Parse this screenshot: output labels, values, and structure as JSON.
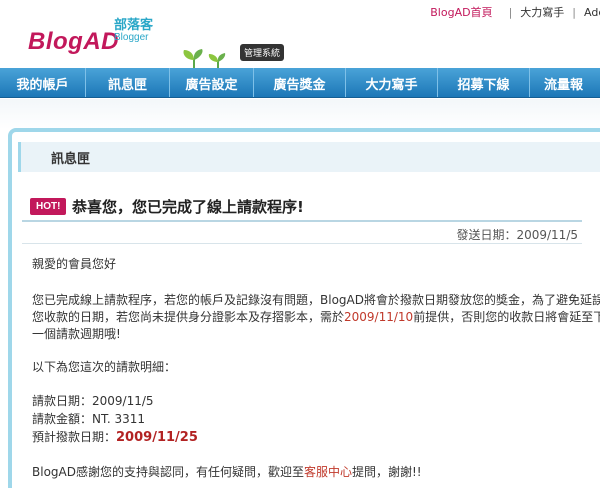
{
  "header": {
    "logo": "BlogAD",
    "logo_sub_zh": "部落客",
    "logo_sub_en": "Blogger",
    "mgmt_badge": "管理系統",
    "toplinks": {
      "home": "BlogAD首頁",
      "writer": "大力寫手",
      "clipped": "Adc"
    }
  },
  "nav": {
    "items": [
      {
        "label": "我的帳戶"
      },
      {
        "label": "訊息匣"
      },
      {
        "label": "廣告設定"
      },
      {
        "label": "廣告獎金"
      },
      {
        "label": "大力寫手"
      },
      {
        "label": "招募下線"
      },
      {
        "label": "流量報"
      }
    ]
  },
  "section": {
    "title": "訊息匣"
  },
  "message": {
    "hot_badge": "HOT!",
    "title": "恭喜您，您已完成了線上請款程序!",
    "sent_date": "發送日期：2009/11/5",
    "greeting": "親愛的會員您好",
    "para1_line1": "您已完成線上請款程序，若您的帳戶及記錄沒有問題，BlogAD將會於撥款日期發放您的獎金，為了避免延誤",
    "para1_line2_a": "您收款的日期，若您尚未提供身分證影本及存摺影本，需於",
    "para1_line2_date": "2009/11/10",
    "para1_line2_b": "前提供，否則您的收款日將會延至下",
    "para1_line3": "一個請款週期哦!",
    "details_intro": "以下為您這次的請款明細：",
    "request_date": "請款日期：2009/11/5",
    "request_amount": "請款金額：NT. 3311",
    "payout_label": "預計撥款日期：",
    "payout_date": "2009/11/25",
    "thanks_a": "BlogAD感謝您的支持與認同，有任何疑問，歡迎至",
    "thanks_link": "客服中心",
    "thanks_b": "提問，謝謝!!"
  },
  "colors": {
    "brand": "#c2185b",
    "nav_blue": "#1c77b7",
    "accent_cyan": "#2aa7c8",
    "date_red": "#c0392b"
  }
}
